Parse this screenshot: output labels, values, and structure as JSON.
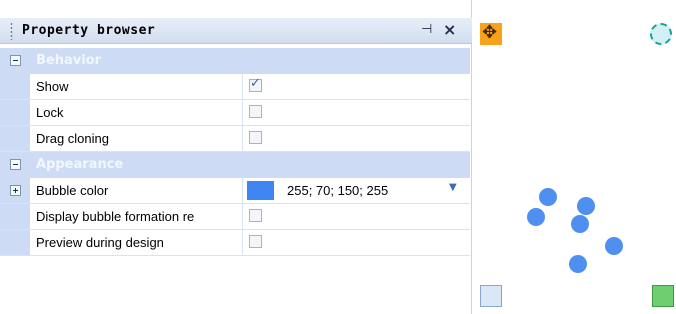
{
  "panel": {
    "title": "Property browser",
    "icons": {
      "pin": "pin-icon",
      "close": "close-icon"
    }
  },
  "categories": {
    "behavior": "Behavior",
    "appearance": "Appearance"
  },
  "properties": {
    "show": {
      "label": "Show",
      "checked": true
    },
    "lock": {
      "label": "Lock",
      "checked": false
    },
    "drag_cloning": {
      "label": "Drag cloning",
      "checked": false
    },
    "bubble_color": {
      "label": "Bubble color",
      "value": "255; 70; 150; 255",
      "swatch": "#3f86f0"
    },
    "display_formation": {
      "label": "Display bubble formation re",
      "checked": false
    },
    "preview_design": {
      "label": "Preview during design",
      "checked": false
    }
  },
  "canvas": {
    "icons": [
      "move-handle-icon",
      "rotate-handle-icon",
      "resize-handle-icon",
      "resize-handle-icon"
    ],
    "bubble_color": "#4f8ff0"
  }
}
